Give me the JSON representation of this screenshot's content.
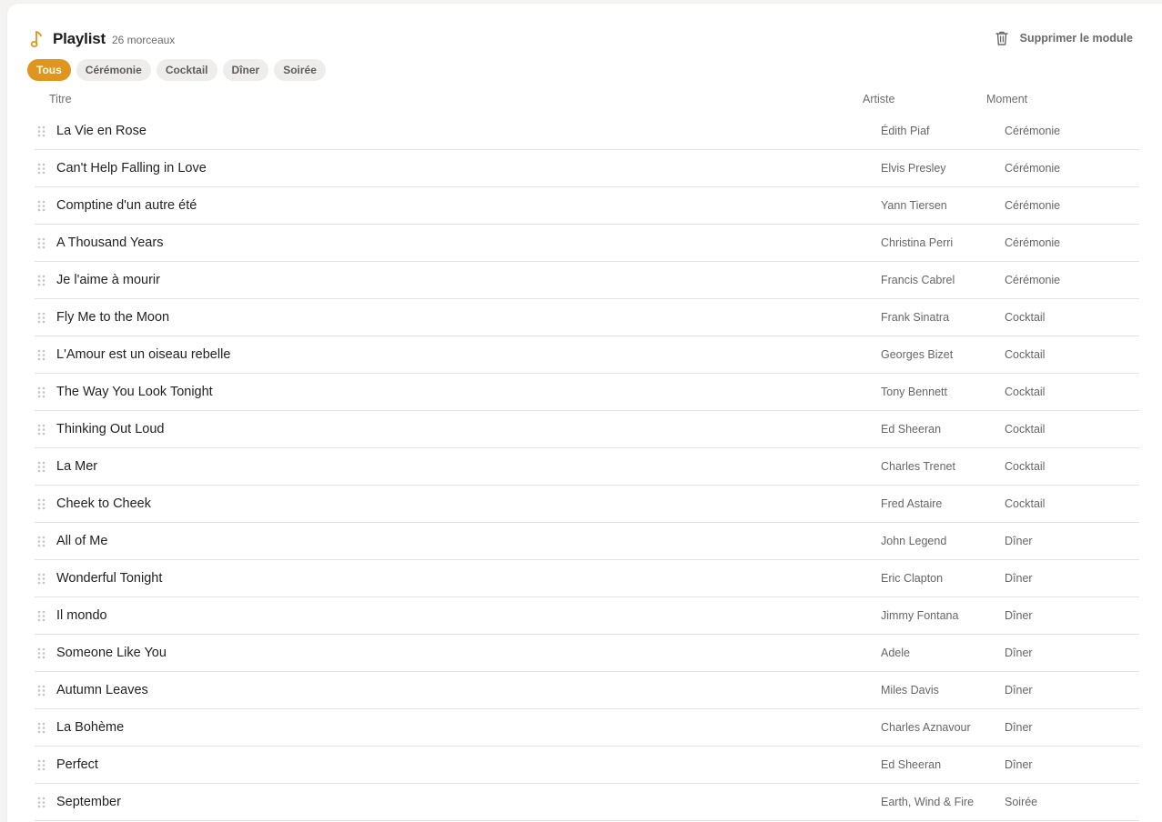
{
  "header": {
    "title": "Playlist",
    "count": "26 morceaux",
    "icon": "music-note-icon",
    "accent": "#e0951f"
  },
  "actions": {
    "delete_label": "Supprimer le module",
    "delete_icon": "trash-icon"
  },
  "filters": [
    {
      "label": "Tous",
      "active": true
    },
    {
      "label": "Cérémonie",
      "active": false
    },
    {
      "label": "Cocktail",
      "active": false
    },
    {
      "label": "Dîner",
      "active": false
    },
    {
      "label": "Soirée",
      "active": false
    }
  ],
  "columns": {
    "title": "Titre",
    "artist": "Artiste",
    "moment": "Moment"
  },
  "tracks": [
    {
      "title": "La Vie en Rose",
      "artist": "Édith Piaf",
      "moment": "Cérémonie"
    },
    {
      "title": "Can't Help Falling in Love",
      "artist": "Elvis Presley",
      "moment": "Cérémonie"
    },
    {
      "title": "Comptine d'un autre été",
      "artist": "Yann Tiersen",
      "moment": "Cérémonie"
    },
    {
      "title": "A Thousand Years",
      "artist": "Christina Perri",
      "moment": "Cérémonie"
    },
    {
      "title": "Je l'aime à mourir",
      "artist": "Francis Cabrel",
      "moment": "Cérémonie"
    },
    {
      "title": "Fly Me to the Moon",
      "artist": "Frank Sinatra",
      "moment": "Cocktail"
    },
    {
      "title": "L'Amour est un oiseau rebelle",
      "artist": "Georges Bizet",
      "moment": "Cocktail"
    },
    {
      "title": "The Way You Look Tonight",
      "artist": "Tony Bennett",
      "moment": "Cocktail"
    },
    {
      "title": "Thinking Out Loud",
      "artist": "Ed Sheeran",
      "moment": "Cocktail"
    },
    {
      "title": "La Mer",
      "artist": "Charles Trenet",
      "moment": "Cocktail"
    },
    {
      "title": "Cheek to Cheek",
      "artist": "Fred Astaire",
      "moment": "Cocktail"
    },
    {
      "title": "All of Me",
      "artist": "John Legend",
      "moment": "Dîner"
    },
    {
      "title": "Wonderful Tonight",
      "artist": "Eric Clapton",
      "moment": "Dîner"
    },
    {
      "title": "Il mondo",
      "artist": "Jimmy Fontana",
      "moment": "Dîner"
    },
    {
      "title": "Someone Like You",
      "artist": "Adele",
      "moment": "Dîner"
    },
    {
      "title": "Autumn Leaves",
      "artist": "Miles Davis",
      "moment": "Dîner"
    },
    {
      "title": "La Bohème",
      "artist": "Charles Aznavour",
      "moment": "Dîner"
    },
    {
      "title": "Perfect",
      "artist": "Ed Sheeran",
      "moment": "Dîner"
    },
    {
      "title": "September",
      "artist": "Earth, Wind & Fire",
      "moment": "Soirée"
    }
  ]
}
